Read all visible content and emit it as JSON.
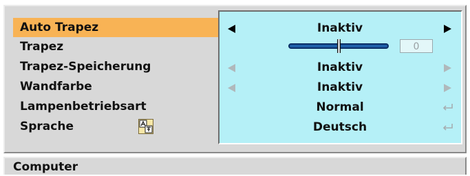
{
  "menu": {
    "items": [
      {
        "label": "Auto Trapez",
        "value": "Inaktiv",
        "control": "arrows",
        "selected": true
      },
      {
        "label": "Trapez",
        "value": "0",
        "control": "slider",
        "slider_level": 0.5
      },
      {
        "label": "Trapez-Speicherung",
        "value": "Inaktiv",
        "control": "arrows-disabled"
      },
      {
        "label": "Wandfarbe",
        "value": "Inaktiv",
        "control": "arrows-disabled"
      },
      {
        "label": "Lampenbetriebsart",
        "value": "Normal",
        "control": "enter"
      },
      {
        "label": "Sprache",
        "value": "Deutsch",
        "control": "enter",
        "icon": "language-icon"
      }
    ]
  },
  "footer": {
    "label": "Computer"
  },
  "colors": {
    "panel_bg": "#d8d8d8",
    "value_box_bg": "#b5f0f7",
    "selected_bg": "#f8b355",
    "slider_fill": "#1e5fa8"
  },
  "icons": {
    "left_arrow": "left-arrow-icon",
    "right_arrow": "right-arrow-icon",
    "enter": "enter-icon",
    "language": "language-icon"
  }
}
